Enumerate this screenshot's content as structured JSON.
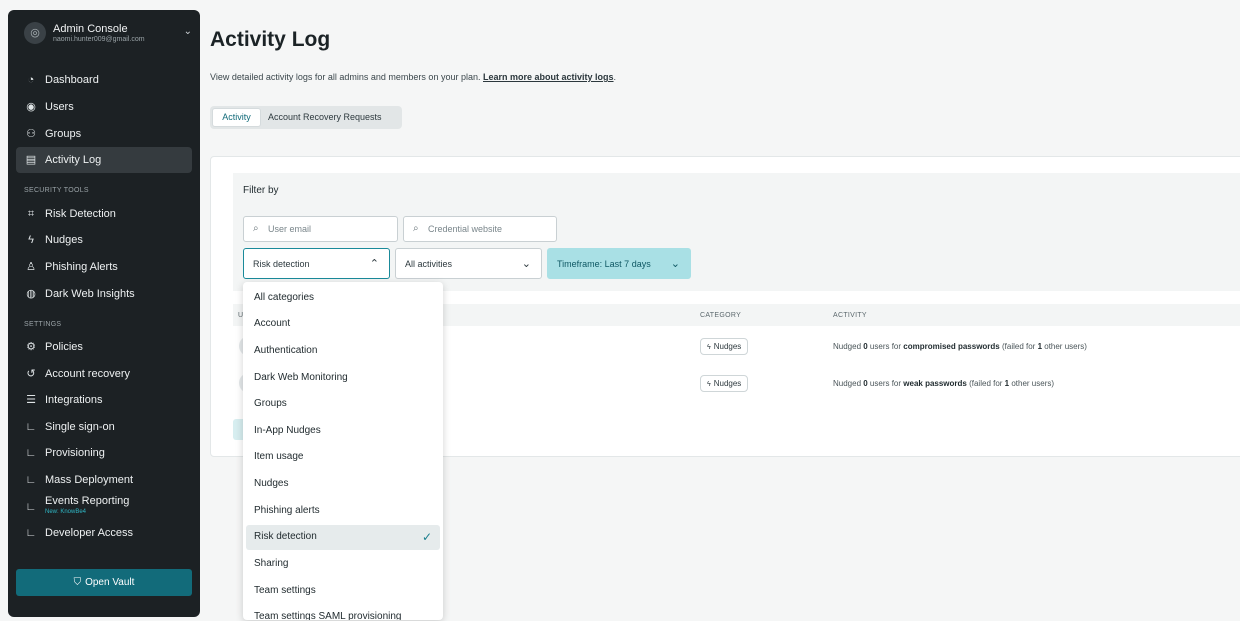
{
  "account": {
    "title": "Admin Console",
    "email": "naomi.hunter009@gmail.com"
  },
  "sidebar": {
    "items": [
      {
        "label": "Dashboard",
        "icon": "dashboard-icon"
      },
      {
        "label": "Users",
        "icon": "user-icon"
      },
      {
        "label": "Groups",
        "icon": "groups-icon"
      },
      {
        "label": "Activity Log",
        "icon": "document-icon"
      }
    ],
    "security_tools_label": "SECURITY TOOLS",
    "security_items": [
      {
        "label": "Risk Detection",
        "icon": "risk-detection-icon"
      },
      {
        "label": "Nudges",
        "icon": "lightning-icon"
      },
      {
        "label": "Phishing Alerts",
        "icon": "phishing-icon"
      },
      {
        "label": "Dark Web Insights",
        "icon": "dark-web-icon"
      }
    ],
    "settings_label": "SETTINGS",
    "settings_items": [
      {
        "label": "Policies",
        "icon": "gear-icon"
      },
      {
        "label": "Account recovery",
        "icon": "recovery-icon"
      },
      {
        "label": "Integrations",
        "icon": "sliders-icon"
      },
      {
        "label": "Single sign-on",
        "icon": "corner-icon"
      },
      {
        "label": "Provisioning",
        "icon": "corner-icon"
      },
      {
        "label": "Mass Deployment",
        "icon": "corner-icon"
      },
      {
        "label": "Events Reporting",
        "sub": "New: KnowBe4",
        "icon": "corner-icon"
      },
      {
        "label": "Developer Access",
        "icon": "corner-icon"
      }
    ],
    "open_vault": "Open Vault"
  },
  "page": {
    "title": "Activity Log",
    "description": "View detailed activity logs for all admins and members on your plan.",
    "learn_more": "Learn more about activity logs",
    "description_end": "."
  },
  "tabs": [
    {
      "label": "Activity",
      "active": true
    },
    {
      "label": "Account Recovery Requests",
      "active": false
    }
  ],
  "filters": {
    "title": "Filter by",
    "user_email_placeholder": "User email",
    "credential_website_placeholder": "Credential website",
    "category_value": "Risk detection",
    "activity_value": "All activities",
    "timeframe_value": "Timeframe: Last 7 days"
  },
  "table": {
    "columns": [
      "CATEGORY",
      "ACTIVITY"
    ],
    "first_column_partial": "U",
    "rows": [
      {
        "category": "Nudges",
        "activity_pre": "Nudged ",
        "count": "0",
        "activity_mid": " users for ",
        "target": "compromised passwords",
        "activity_post1": " (failed for ",
        "failed": "1",
        "activity_post2": " other users)"
      },
      {
        "category": "Nudges",
        "activity_pre": "Nudged ",
        "count": "0",
        "activity_mid": " users for ",
        "target": "weak passwords",
        "activity_post1": " (failed for ",
        "failed": "1",
        "activity_post2": " other users)"
      }
    ]
  },
  "dropdown": {
    "options": [
      "All categories",
      "Account",
      "Authentication",
      "Dark Web Monitoring",
      "Groups",
      "In-App Nudges",
      "Item usage",
      "Nudges",
      "Phishing alerts",
      "Risk detection",
      "Sharing",
      "Team settings",
      "Team settings SAML provisioning"
    ],
    "selected": "Risk detection"
  },
  "colors": {
    "sidebar_bg": "#1c2124",
    "accent": "#126b7a",
    "timeframe_bg": "#a9e0e5"
  }
}
